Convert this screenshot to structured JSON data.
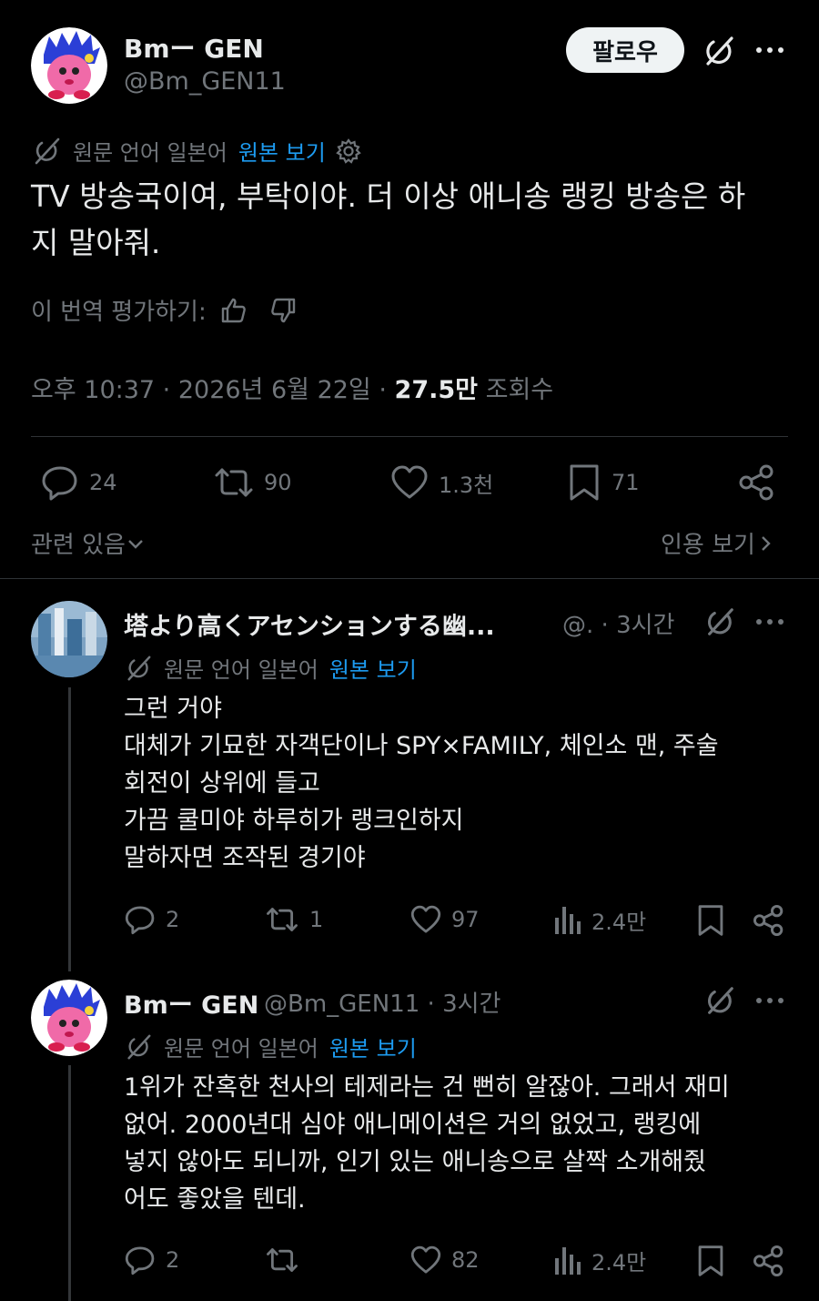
{
  "main_post": {
    "author_name": "Bmー GEN",
    "author_handle": "@Bm_GEN11",
    "follow_label": "팔로우",
    "translation_note": "원문 언어 일본어",
    "view_original": "원본 보기",
    "text_line1": "TV 방송국이여, 부탁이야. 더 이상 애니송 랭킹 방송은 하",
    "text_line2": "지 말아줘.",
    "rate_translation": "이 번역 평가하기:",
    "time": "오후 10:37",
    "date": "2026년 6월 22일",
    "views": "27.5만",
    "views_label": "조회수",
    "replies": "24",
    "reposts": "90",
    "likes": "1.3천",
    "bookmarks": "71",
    "related_label": "관련 있음",
    "quotes_label": "인용 보기"
  },
  "replies": [
    {
      "author_name": "塔より高くアセンションする幽...",
      "author_handle": "@.",
      "time": "3시간",
      "translation_note": "원문 언어 일본어",
      "view_original": "원본 보기",
      "lines": [
        "그런 거야",
        "대체가 기묘한 자객단이나 SPY×FAMILY, 체인소 맨, 주술",
        "회전이 상위에 들고",
        "가끔 쿨미야 하루히가 랭크인하지",
        "말하자면 조작된 경기야"
      ],
      "replies": "2",
      "reposts": "1",
      "likes": "97",
      "views": "2.4만"
    },
    {
      "author_name": "Bmー GEN",
      "author_handle": "@Bm_GEN11",
      "time": "3시간",
      "translation_note": "원문 언어 일본어",
      "view_original": "원본 보기",
      "lines": [
        "1위가 잔혹한 천사의 테제라는 건 뻔히 알잖아. 그래서 재미",
        "없어. 2000년대 심야 애니메이션은 거의 없었고, 랭킹에",
        "넣지 않아도 되니까, 인기 있는 애니송으로 살짝 소개해줬",
        "어도 좋았을 텐데."
      ],
      "replies": "2",
      "reposts": "",
      "likes": "82",
      "views": "2.4만"
    }
  ],
  "icons": {
    "reply": "speech-bubble-icon",
    "repost": "repost-arrows-icon",
    "like": "heart-icon",
    "bookmark": "bookmark-icon",
    "share": "share-nodes-icon",
    "views": "bar-chart-icon",
    "grok": "grok-slash-icon",
    "more": "more-dots-icon",
    "translate": "translate-slash-icon",
    "settings": "gear-icon",
    "thumbs_up": "thumbs-up-icon",
    "thumbs_down": "thumbs-down-icon"
  },
  "colors": {
    "background": "#000000",
    "text_primary": "#e7e9ea",
    "text_secondary": "#71767b",
    "link_blue": "#1d9bf0",
    "follow_button_bg": "#eff3f4",
    "divider": "#2f3336"
  }
}
